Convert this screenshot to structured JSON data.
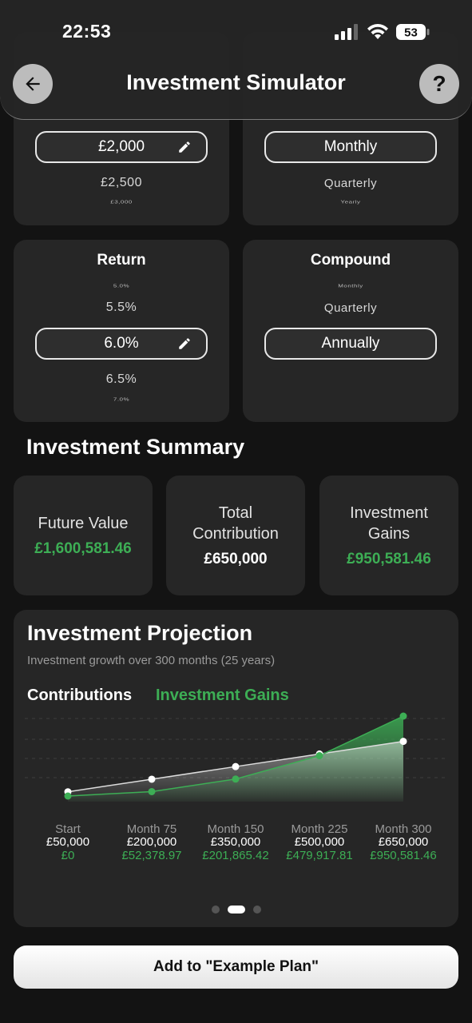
{
  "status": {
    "time": "22:53",
    "battery": "53"
  },
  "header": {
    "title": "Investment Simulator",
    "help": "?"
  },
  "contribution": {
    "visible_options": [
      "£2,000",
      "£2,500",
      "£3,000"
    ],
    "selected": "£2,000"
  },
  "frequency": {
    "visible_options": [
      "Monthly",
      "Quarterly",
      "Yearly"
    ],
    "selected": "Monthly"
  },
  "return": {
    "title": "Return",
    "options": [
      "5.0%",
      "5.5%",
      "6.0%",
      "6.5%",
      "7.0%"
    ],
    "selected": "6.0%"
  },
  "compound": {
    "title": "Compound",
    "options": [
      "Monthly",
      "Quarterly",
      "Annually"
    ],
    "selected": "Annually"
  },
  "summary": {
    "title": "Investment Summary",
    "cards": [
      {
        "label": "Future Value",
        "value": "£1,600,581.46",
        "color": "#3dae55"
      },
      {
        "label": "Total Contribution",
        "value": "£650,000",
        "color": "#ffffff"
      },
      {
        "label": "Investment Gains",
        "value": "£950,581.46",
        "color": "#3dae55"
      }
    ]
  },
  "projection": {
    "title": "Investment Projection",
    "subtitle": "Investment growth over 300 months (25 years)",
    "legend": {
      "contributions": "Contributions",
      "gains": "Investment Gains"
    },
    "pager": {
      "pages": 3,
      "active": 2
    }
  },
  "chart_data": {
    "type": "line",
    "categories": [
      "Start",
      "Month 75",
      "Month 150",
      "Month 225",
      "Month 300"
    ],
    "series": [
      {
        "name": "Contributions",
        "color": "#ffffff",
        "values": [
          50000,
          200000,
          350000,
          500000,
          650000
        ],
        "labels": [
          "£50,000",
          "£200,000",
          "£350,000",
          "£500,000",
          "£650,000"
        ]
      },
      {
        "name": "Investment Gains",
        "color": "#3dae55",
        "values": [
          0,
          52378.97,
          201865.42,
          479917.81,
          950581.46
        ],
        "labels": [
          "£0",
          "£52,378.97",
          "£201,865.42",
          "£479,917.81",
          "£950,581.46"
        ]
      }
    ],
    "grid": true
  },
  "action": {
    "label": "Add to \"Example Plan\""
  }
}
